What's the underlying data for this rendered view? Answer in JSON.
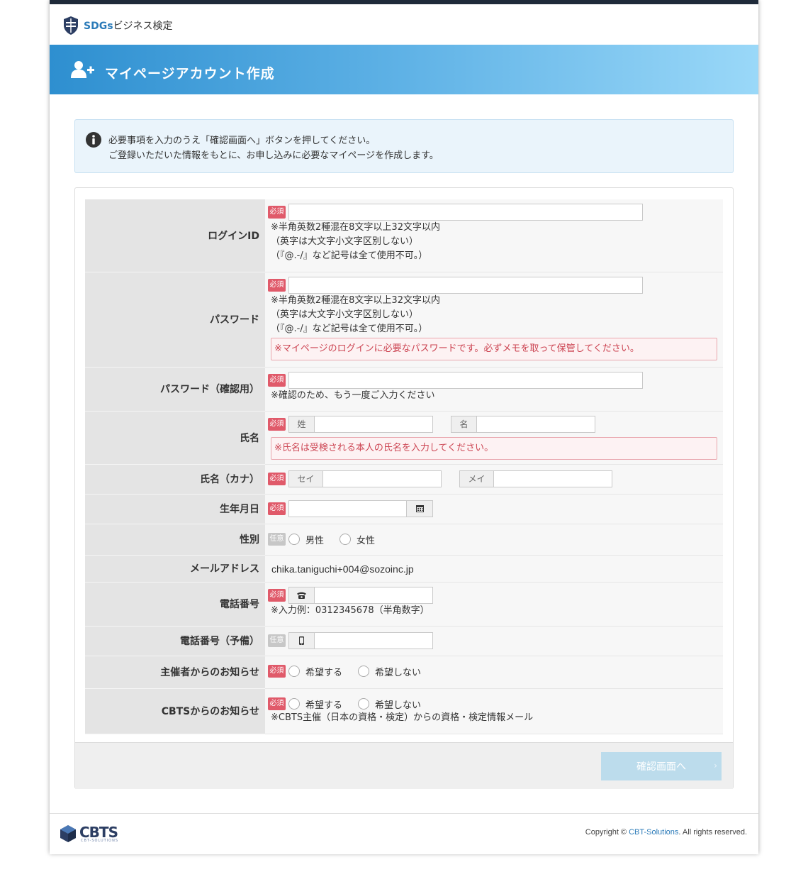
{
  "header": {
    "logo_sdgs": "SDGs",
    "logo_suffix": "ビジネス検定",
    "banner_title": "マイページアカウント作成"
  },
  "info": {
    "line1": "必要事項を入力のうえ「確認画面へ」ボタンを押してください。",
    "line2": "ご登録いただいた情報をもとに、お申し込みに必要なマイページを作成します。"
  },
  "badges": {
    "required": "必須",
    "optional": "任意"
  },
  "form": {
    "login_id": {
      "label": "ログインID",
      "value": "",
      "notes": [
        "※半角英数2種混在8文字以上32文字以内",
        "（英字は大文字小文字区別しない）",
        "（『@.-/』など記号は全て使用不可。）"
      ]
    },
    "password": {
      "label": "パスワード",
      "value": "",
      "notes": [
        "※半角英数2種混在8文字以上32文字以内",
        "（英字は大文字小文字区別しない）",
        "（『@.-/』など記号は全て使用不可。）"
      ],
      "warning": "※マイページのログインに必要なパスワードです。必ずメモを取って保管してください。"
    },
    "password_confirm": {
      "label": "パスワード（確認用）",
      "value": "",
      "note": "※確認のため、もう一度ご入力ください"
    },
    "name": {
      "label": "氏名",
      "last_addon": "姓",
      "first_addon": "名",
      "last_value": "",
      "first_value": "",
      "warning": "※氏名は受検される本人の氏名を入力してください。"
    },
    "name_kana": {
      "label": "氏名（カナ）",
      "last_addon": "セイ",
      "first_addon": "メイ",
      "last_value": "",
      "first_value": ""
    },
    "birthday": {
      "label": "生年月日",
      "value": "",
      "icon": "calendar-icon"
    },
    "gender": {
      "label": "性別",
      "options": [
        "男性",
        "女性"
      ]
    },
    "email": {
      "label": "メールアドレス",
      "value": "chika.taniguchi+004@sozoinc.jp"
    },
    "phone": {
      "label": "電話番号",
      "value": "",
      "icon": "telephone-icon",
      "note": "※入力例：0312345678（半角数字）"
    },
    "phone_spare": {
      "label": "電話番号（予備）",
      "value": "",
      "icon": "mobile-phone-icon"
    },
    "organizer_notice": {
      "label": "主催者からのお知らせ",
      "options": [
        "希望する",
        "希望しない"
      ]
    },
    "cbts_notice": {
      "label": "CBTSからのお知らせ",
      "options": [
        "希望する",
        "希望しない"
      ],
      "note": "※CBTS主催（日本の資格・検定）からの資格・検定情報メール"
    }
  },
  "confirm_button": "確認画面へ",
  "footer": {
    "logo_text": "CBTS",
    "logo_sub": "CBT-SOLUTIONS",
    "copyright_prefix": "Copyright © ",
    "copyright_link": "CBT-Solutions",
    "copyright_suffix": ". All rights reserved."
  },
  "colors": {
    "banner_start": "#2e8fd0",
    "banner_end": "#9ad8f8",
    "required_badge": "#e05a6a",
    "optional_badge": "#c7c7c7",
    "warning_text": "#cc4452",
    "button_disabled": "#bcdcec"
  }
}
